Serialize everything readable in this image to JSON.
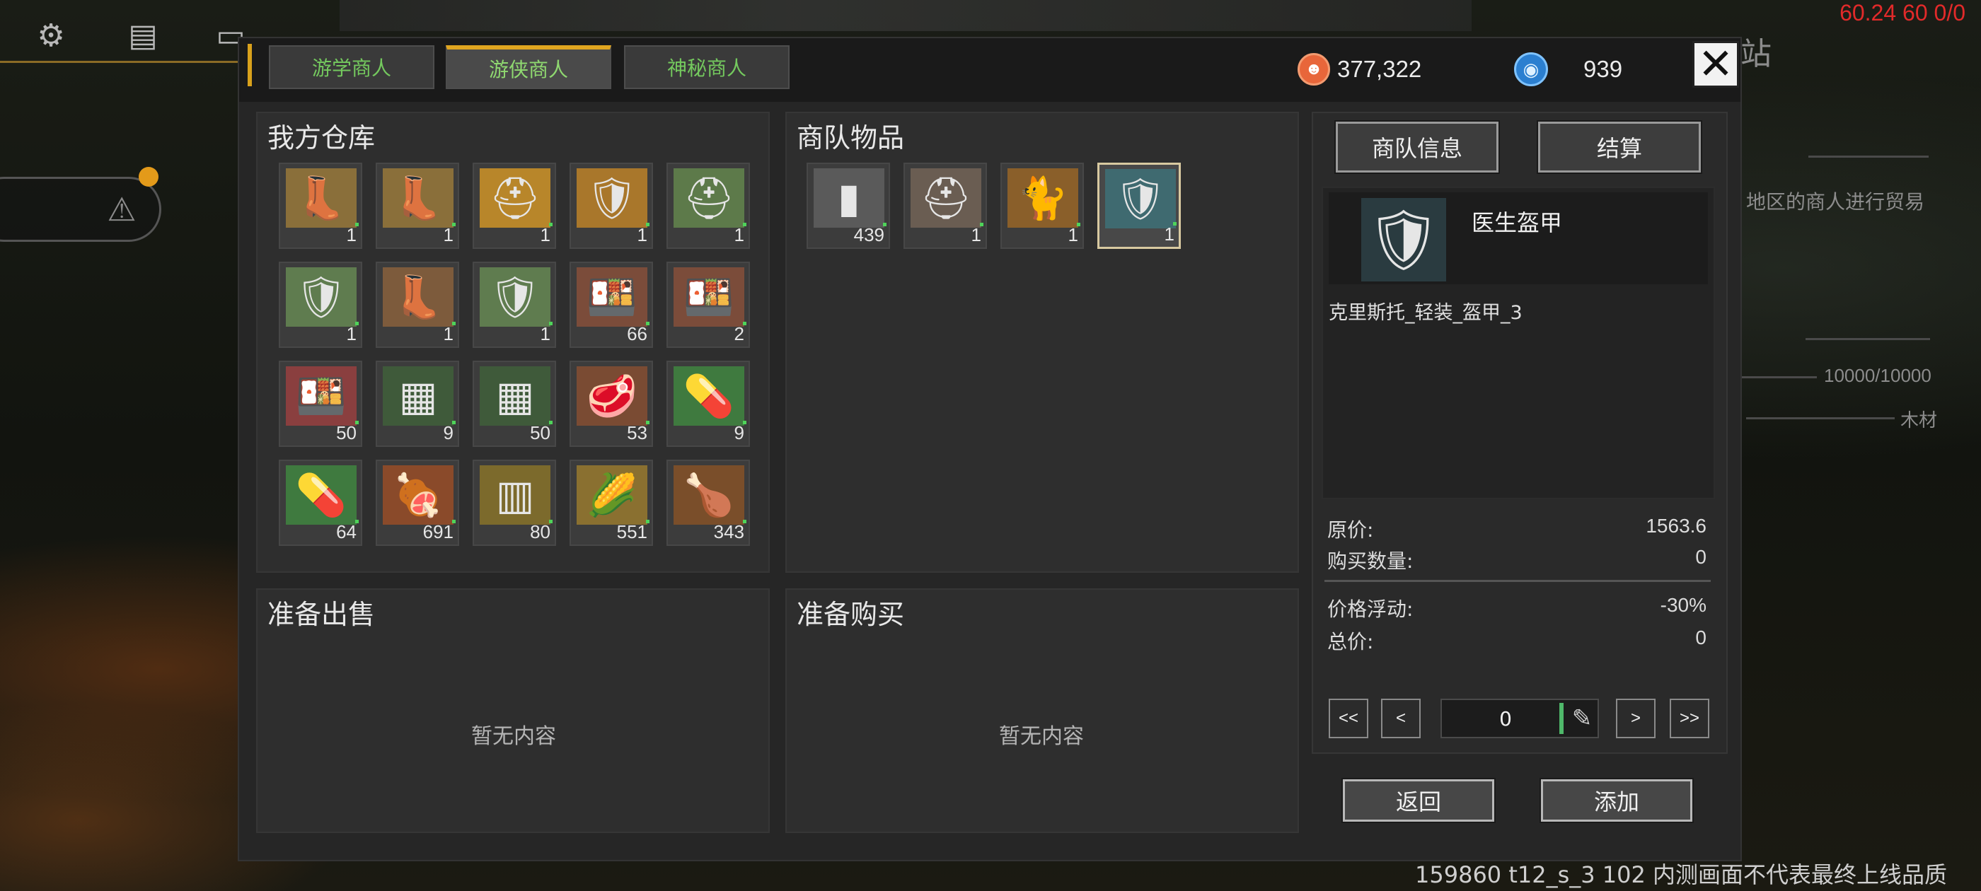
{
  "hud": {
    "fps": "60.24 60 0/0",
    "build_info": "159860 t12_s_3 102  内测画面不代表最终上线品质",
    "bg_texts": [
      "站",
      "地区的商人进行贸易",
      "10000/10000",
      "木材"
    ]
  },
  "tabs": [
    {
      "label": "游学商人",
      "active": false
    },
    {
      "label": "游侠商人",
      "active": true
    },
    {
      "label": "神秘商人",
      "active": false
    }
  ],
  "currency": {
    "coins": "377,322",
    "gems": "939"
  },
  "warehouse": {
    "title": "我方仓库",
    "items": [
      {
        "icon": "boots-icon",
        "count": "1"
      },
      {
        "icon": "boots-icon",
        "count": "1"
      },
      {
        "icon": "gold-helmet-icon",
        "count": "1"
      },
      {
        "icon": "gold-armor-icon",
        "count": "1"
      },
      {
        "icon": "green-helmet-icon",
        "count": "1"
      },
      {
        "icon": "green-armor-icon",
        "count": "1"
      },
      {
        "icon": "armored-boots-icon",
        "count": "1"
      },
      {
        "icon": "green-armor-icon",
        "count": "1"
      },
      {
        "icon": "meal-plate-icon",
        "count": "66"
      },
      {
        "icon": "meal-plate-icon",
        "count": "2"
      },
      {
        "icon": "meal-tray-icon",
        "count": "50"
      },
      {
        "icon": "ammo-crate-icon",
        "count": "9"
      },
      {
        "icon": "ammo-crate-icon",
        "count": "50"
      },
      {
        "icon": "meat-plate-icon",
        "count": "53"
      },
      {
        "icon": "medicine-capsule-icon",
        "count": "9"
      },
      {
        "icon": "medicine-capsule-icon",
        "count": "64"
      },
      {
        "icon": "meat-crate-icon",
        "count": "691"
      },
      {
        "icon": "wooden-crate-icon",
        "count": "80"
      },
      {
        "icon": "corn-crate-icon",
        "count": "551"
      },
      {
        "icon": "food-plate-icon",
        "count": "343"
      }
    ]
  },
  "caravan": {
    "title": "商队物品",
    "items": [
      {
        "icon": "steel-ingot-icon",
        "count": "439",
        "selected": false
      },
      {
        "icon": "steel-helmet-icon",
        "count": "1",
        "selected": false
      },
      {
        "icon": "cat-icon",
        "count": "1",
        "selected": false
      },
      {
        "icon": "doctor-armor-icon",
        "count": "1",
        "selected": true
      }
    ]
  },
  "sell": {
    "title": "准备出售",
    "empty": "暂无内容"
  },
  "buy": {
    "title": "准备购买",
    "empty": "暂无内容"
  },
  "detail": {
    "info_button": "商队信息",
    "settle_button": "结算",
    "item_name": "医生盔甲",
    "item_id": "克里斯托_轻装_盔甲_3",
    "price_label": "原价:",
    "price_value": "1563.6",
    "qty_label": "购买数量:",
    "qty_value": "0",
    "fluct_label": "价格浮动:",
    "fluct_value": "-30%",
    "total_label": "总价:",
    "total_value": "0",
    "stepper": {
      "first": "<<",
      "prev": "<",
      "value": "0",
      "next": ">",
      "last": ">>"
    },
    "back_button": "返回",
    "add_button": "添加"
  }
}
